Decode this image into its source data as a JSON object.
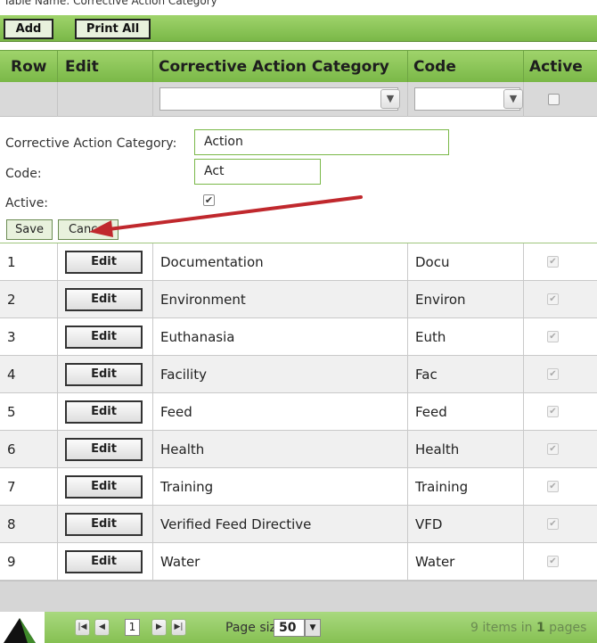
{
  "caption": "Table Name: Corrective Action Category",
  "toolbar": {
    "add_label": "Add",
    "print_label": "Print All"
  },
  "columns": {
    "row": "Row",
    "edit": "Edit",
    "category": "Corrective Action Category",
    "code": "Code",
    "active": "Active"
  },
  "form": {
    "category_label": "Corrective Action Category:",
    "category_value": "Action",
    "code_label": "Code:",
    "code_value": "Act",
    "active_label": "Active:",
    "active_checked": true,
    "save_label": "Save",
    "cancel_label": "Cancel"
  },
  "edit_button_label": "Edit",
  "rows": [
    {
      "row": "1",
      "category": "Documentation",
      "code": "Docu",
      "active": true
    },
    {
      "row": "2",
      "category": "Environment",
      "code": "Environ",
      "active": true
    },
    {
      "row": "3",
      "category": "Euthanasia",
      "code": "Euth",
      "active": true
    },
    {
      "row": "4",
      "category": "Facility",
      "code": "Fac",
      "active": true
    },
    {
      "row": "5",
      "category": "Feed",
      "code": "Feed",
      "active": true
    },
    {
      "row": "6",
      "category": "Health",
      "code": "Health",
      "active": true
    },
    {
      "row": "7",
      "category": "Training",
      "code": "Training",
      "active": true
    },
    {
      "row": "8",
      "category": "Verified Feed Directive",
      "code": "VFD",
      "active": true
    },
    {
      "row": "9",
      "category": "Water",
      "code": "Water",
      "active": true
    }
  ],
  "pager": {
    "current_page": "1",
    "page_size_label": "Page size:",
    "page_size": "50",
    "items_count": "9",
    "items_mid": "items in",
    "pages_count": "1",
    "pages_word": "pages"
  },
  "colors": {
    "header_green": "#8cc35c",
    "arrow_red": "#c0282d"
  }
}
